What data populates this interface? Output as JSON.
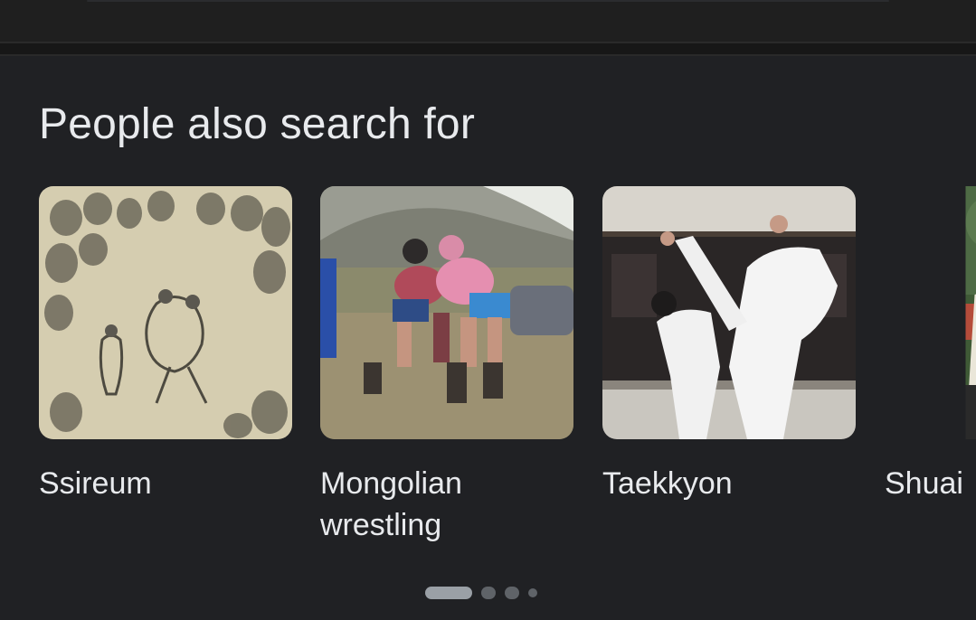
{
  "section": {
    "title": "People also search for"
  },
  "cards": [
    {
      "label": "Ssireum",
      "image": "ssireum-painting-image"
    },
    {
      "label": "Mongolian wrestling",
      "image": "mongolian-wrestling-photo"
    },
    {
      "label": "Taekkyon",
      "image": "taekkyon-photo"
    },
    {
      "label": "Shuai",
      "image": "shuai-jiao-photo"
    }
  ],
  "carousel": {
    "pages": 4,
    "active_page": 1
  },
  "colors": {
    "background": "#202124",
    "text": "#e8eaed",
    "dot_active": "#9aa0a6",
    "dot_inactive": "#5f6368"
  }
}
